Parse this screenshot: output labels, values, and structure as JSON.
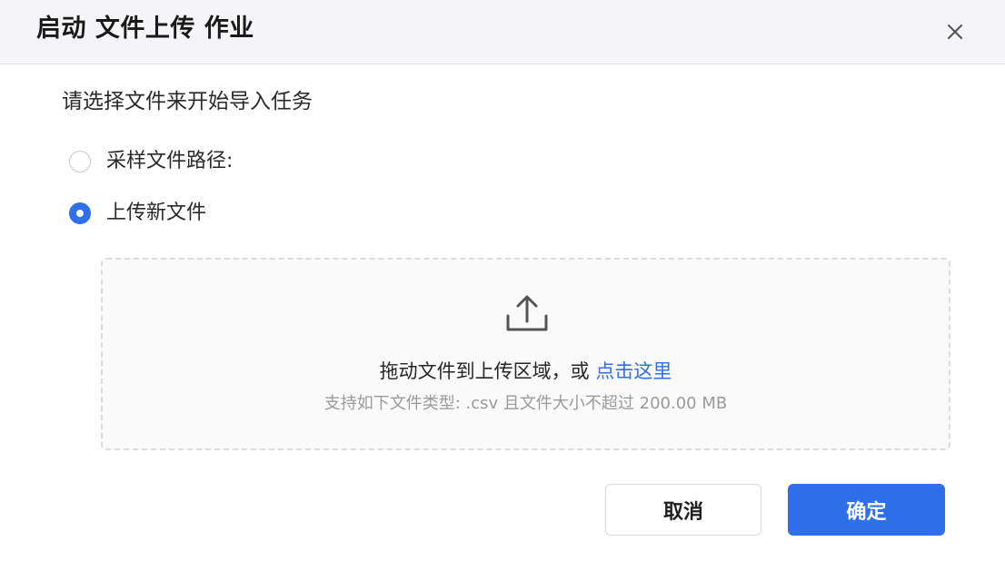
{
  "dialog": {
    "title": "启动 文件上传 作业",
    "close_icon": "close-icon",
    "instruction": "请选择文件来开始导入任务",
    "options": [
      {
        "label": "采样文件路径:",
        "checked": false
      },
      {
        "label": "上传新文件",
        "checked": true
      }
    ],
    "dropzone": {
      "icon": "upload-icon",
      "text": "拖动文件到上传区域，或 ",
      "link": "点击这里",
      "hint": "支持如下文件类型: .csv 且文件大小不超过 200.00 MB"
    },
    "buttons": {
      "cancel": "取消",
      "confirm": "确定"
    },
    "colors": {
      "accent": "#2f6fe9",
      "header_bg": "#f5f5f7",
      "hint_text": "#9a9a9f"
    }
  }
}
